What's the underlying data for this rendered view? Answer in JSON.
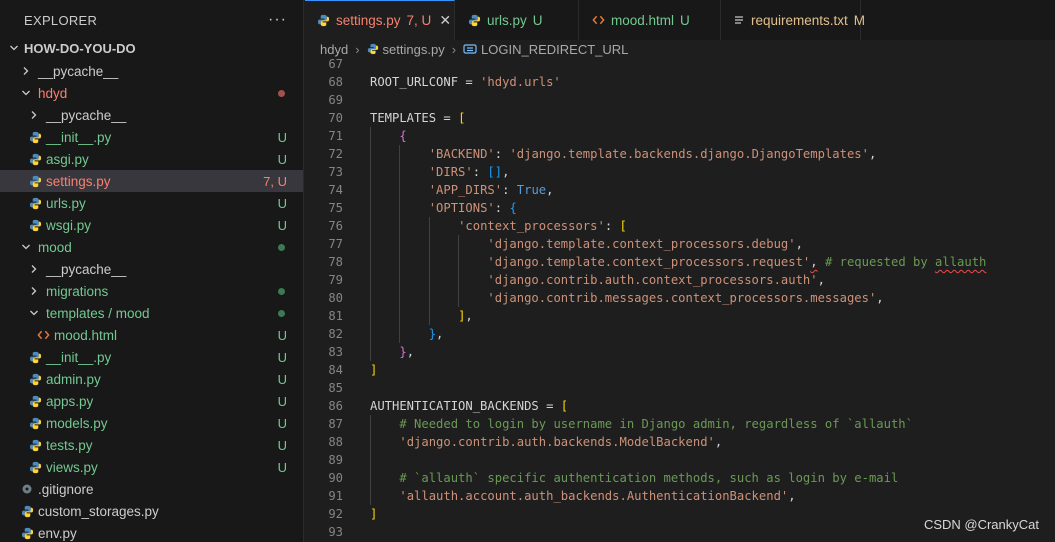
{
  "colors": {
    "untracked": "#73c991",
    "modified": "#e2c08d",
    "error": "#f88070",
    "accent": "#3794ff",
    "keyword_blue": "#569cd6",
    "string": "#ce9178",
    "comment": "#6a9955",
    "bracket_gold": "#ffd700",
    "bracket_purple": "#da70d6",
    "bracket_blue": "#179fff"
  },
  "explorer": {
    "title": "EXPLORER",
    "more_label": "···",
    "project": "HOW-DO-YOU-DO",
    "items": [
      {
        "label": "__pycache__",
        "indent": 0,
        "type": "folder",
        "expanded": false,
        "color": "#cccccc",
        "status": "",
        "status_color": "",
        "dot": ""
      },
      {
        "label": "hdyd",
        "indent": 0,
        "type": "folder",
        "expanded": true,
        "color": "#f88070",
        "status": "",
        "status_color": "",
        "dot": "#a1524c"
      },
      {
        "label": "__pycache__",
        "indent": 1,
        "type": "folder",
        "expanded": false,
        "color": "#cccccc",
        "status": "",
        "status_color": "",
        "dot": ""
      },
      {
        "label": "__init__.py",
        "indent": 1,
        "type": "python",
        "color": "#73c991",
        "status": "U",
        "status_color": "#73c991",
        "dot": ""
      },
      {
        "label": "asgi.py",
        "indent": 1,
        "type": "python",
        "color": "#73c991",
        "status": "U",
        "status_color": "#73c991",
        "dot": ""
      },
      {
        "label": "settings.py",
        "indent": 1,
        "type": "python",
        "color": "#f88070",
        "status": "7, U",
        "status_color": "#f88070",
        "dot": "",
        "selected": true
      },
      {
        "label": "urls.py",
        "indent": 1,
        "type": "python",
        "color": "#73c991",
        "status": "U",
        "status_color": "#73c991",
        "dot": ""
      },
      {
        "label": "wsgi.py",
        "indent": 1,
        "type": "python",
        "color": "#73c991",
        "status": "U",
        "status_color": "#73c991",
        "dot": ""
      },
      {
        "label": "mood",
        "indent": 0,
        "type": "folder",
        "expanded": true,
        "color": "#73c991",
        "status": "",
        "status_color": "",
        "dot": "#3c7a56"
      },
      {
        "label": "__pycache__",
        "indent": 1,
        "type": "folder",
        "expanded": false,
        "color": "#cccccc",
        "status": "",
        "status_color": "",
        "dot": ""
      },
      {
        "label": "migrations",
        "indent": 1,
        "type": "folder",
        "expanded": false,
        "color": "#73c991",
        "status": "",
        "status_color": "",
        "dot": "#3c7a56"
      },
      {
        "label": "templates / mood",
        "indent": 1,
        "type": "folder",
        "expanded": true,
        "color": "#73c991",
        "status": "",
        "status_color": "",
        "dot": "#3c7a56"
      },
      {
        "label": "mood.html",
        "indent": 2,
        "type": "html",
        "color": "#73c991",
        "status": "U",
        "status_color": "#73c991",
        "dot": ""
      },
      {
        "label": "__init__.py",
        "indent": 1,
        "type": "python",
        "color": "#73c991",
        "status": "U",
        "status_color": "#73c991",
        "dot": ""
      },
      {
        "label": "admin.py",
        "indent": 1,
        "type": "python",
        "color": "#73c991",
        "status": "U",
        "status_color": "#73c991",
        "dot": ""
      },
      {
        "label": "apps.py",
        "indent": 1,
        "type": "python",
        "color": "#73c991",
        "status": "U",
        "status_color": "#73c991",
        "dot": ""
      },
      {
        "label": "models.py",
        "indent": 1,
        "type": "python",
        "color": "#73c991",
        "status": "U",
        "status_color": "#73c991",
        "dot": ""
      },
      {
        "label": "tests.py",
        "indent": 1,
        "type": "python",
        "color": "#73c991",
        "status": "U",
        "status_color": "#73c991",
        "dot": ""
      },
      {
        "label": "views.py",
        "indent": 1,
        "type": "python",
        "color": "#73c991",
        "status": "U",
        "status_color": "#73c991",
        "dot": ""
      },
      {
        "label": ".gitignore",
        "indent": 0,
        "type": "gitignore",
        "color": "#cccccc",
        "status": "",
        "status_color": "",
        "dot": ""
      },
      {
        "label": "custom_storages.py",
        "indent": 0,
        "type": "python",
        "color": "#cccccc",
        "status": "",
        "status_color": "",
        "dot": ""
      },
      {
        "label": "env.py",
        "indent": 0,
        "type": "python",
        "color": "#cccccc",
        "status": "",
        "status_color": "",
        "dot": ""
      }
    ]
  },
  "tabs": [
    {
      "label": "settings.py",
      "status": "7, U",
      "icon": "python-icon",
      "active": true,
      "color": "#f88070",
      "status_color": "#f88070",
      "close": "✕"
    },
    {
      "label": "urls.py",
      "status": "U",
      "icon": "python-icon",
      "active": false,
      "color": "#73c991",
      "status_color": "#73c991",
      "close": ""
    },
    {
      "label": "mood.html",
      "status": "U",
      "icon": "html-icon",
      "active": false,
      "color": "#73c991",
      "status_color": "#73c991",
      "close": ""
    },
    {
      "label": "requirements.txt",
      "status": "M",
      "icon": "text-file-icon",
      "active": false,
      "color": "#e2c08d",
      "status_color": "#e2c08d",
      "close": ""
    }
  ],
  "breadcrumb": {
    "folder": "hdyd",
    "file": "settings.py",
    "symbol": "LOGIN_REDIRECT_URL",
    "separator": "›"
  },
  "code": {
    "first_line": 67,
    "lines": [
      [
        [
          "67",
          "n"
        ]
      ],
      [
        [
          "ROOT_URLCONF = ",
          "p"
        ],
        [
          "'hdyd.urls'",
          "s"
        ]
      ],
      [],
      [
        [
          "TEMPLATES = ",
          "p"
        ],
        [
          "[",
          "b1"
        ]
      ],
      [
        [
          "    ",
          "p"
        ],
        [
          "{",
          "b2"
        ]
      ],
      [
        [
          "        ",
          "p"
        ],
        [
          "'BACKEND'",
          "s"
        ],
        [
          ": ",
          "p"
        ],
        [
          "'django.template.backends.django.DjangoTemplates'",
          "s"
        ],
        [
          ",",
          "p"
        ]
      ],
      [
        [
          "        ",
          "p"
        ],
        [
          "'DIRS'",
          "s"
        ],
        [
          ": ",
          "p"
        ],
        [
          "[]",
          "b3"
        ],
        [
          ",",
          "p"
        ]
      ],
      [
        [
          "        ",
          "p"
        ],
        [
          "'APP_DIRS'",
          "s"
        ],
        [
          ": ",
          "p"
        ],
        [
          "True",
          "k"
        ],
        [
          ",",
          "p"
        ]
      ],
      [
        [
          "        ",
          "p"
        ],
        [
          "'OPTIONS'",
          "s"
        ],
        [
          ": ",
          "p"
        ],
        [
          "{",
          "b3"
        ]
      ],
      [
        [
          "            ",
          "p"
        ],
        [
          "'context_processors'",
          "s"
        ],
        [
          ": ",
          "p"
        ],
        [
          "[",
          "b1"
        ]
      ],
      [
        [
          "                ",
          "p"
        ],
        [
          "'django.template.context_processors.debug'",
          "s"
        ],
        [
          ",",
          "p"
        ]
      ],
      [
        [
          "                ",
          "p"
        ],
        [
          "'django.template.context_processors.request'",
          "s"
        ],
        [
          ",",
          "sq"
        ],
        [
          " # requested by ",
          "c"
        ],
        [
          "allauth",
          "csq"
        ]
      ],
      [
        [
          "                ",
          "p"
        ],
        [
          "'django.contrib.auth.context_processors.auth'",
          "s"
        ],
        [
          ",",
          "p"
        ]
      ],
      [
        [
          "                ",
          "p"
        ],
        [
          "'django.contrib.messages.context_processors.messages'",
          "s"
        ],
        [
          ",",
          "p"
        ]
      ],
      [
        [
          "            ",
          "p"
        ],
        [
          "]",
          "b1"
        ],
        [
          ",",
          "p"
        ]
      ],
      [
        [
          "        ",
          "p"
        ],
        [
          "}",
          "b3"
        ],
        [
          ",",
          "p"
        ]
      ],
      [
        [
          "    ",
          "p"
        ],
        [
          "}",
          "b2"
        ],
        [
          ",",
          "p"
        ]
      ],
      [
        [
          "]",
          "b1"
        ]
      ],
      [],
      [
        [
          "AUTHENTICATION_BACKENDS = ",
          "p"
        ],
        [
          "[",
          "b1"
        ]
      ],
      [
        [
          "    ",
          "p"
        ],
        [
          "# Needed to login by username in Django admin, regardless of `allauth`",
          "c"
        ]
      ],
      [
        [
          "    ",
          "p"
        ],
        [
          "'django.contrib.auth.backends.ModelBackend'",
          "s"
        ],
        [
          ",",
          "p"
        ]
      ],
      [],
      [
        [
          "    ",
          "p"
        ],
        [
          "# `allauth` specific authentication methods, such as login by e-mail",
          "c"
        ]
      ],
      [
        [
          "    ",
          "p"
        ],
        [
          "'allauth.account.auth_backends.AuthenticationBackend'",
          "s"
        ],
        [
          ",",
          "p"
        ]
      ],
      [
        [
          "]",
          "b1"
        ]
      ],
      []
    ]
  },
  "watermark": "CSDN @CrankyCat"
}
